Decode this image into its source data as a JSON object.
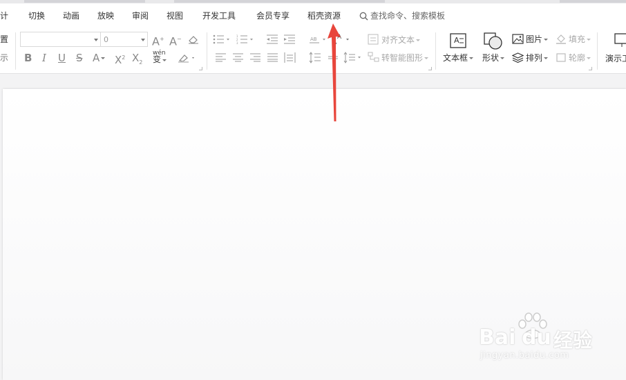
{
  "menu": {
    "items": [
      "设计",
      "切换",
      "动画",
      "放映",
      "审阅",
      "视图",
      "开发工具",
      "会员专享",
      "稻壳资源"
    ],
    "search_placeholder": "查找命令、搜索模板"
  },
  "ribbon": {
    "left_partial_1": "置",
    "left_partial_2": "示",
    "font_name": "",
    "font_size": "0",
    "align_text": "对齐文本",
    "smartart": "转智能图形",
    "textbox": "文本框",
    "shape": "形状",
    "picture": "图片",
    "arrange": "排列",
    "fill": "填充",
    "outline": "轮廓",
    "present": "演示工",
    "wen": "wén",
    "wen_char": "变"
  },
  "watermark": {
    "brand": "Bai",
    "brand2": "du",
    "cn": "经验",
    "url": "jingyan.baidu.com"
  },
  "colors": {
    "arrow": "#e8463c",
    "accent": "#d9d9d9"
  }
}
